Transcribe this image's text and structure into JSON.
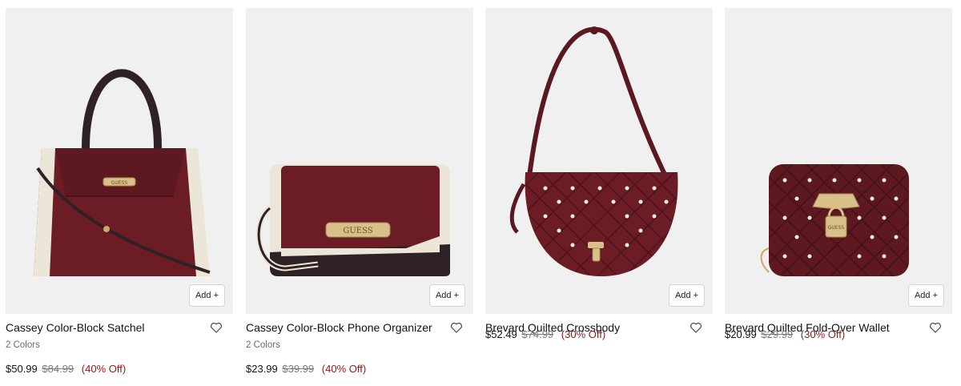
{
  "products": [
    {
      "name": "Cassey Color-Block Satchel",
      "colors": "2 Colors",
      "sale_price": "$50.99",
      "original_price": "$84.99",
      "discount": "(40% Off)",
      "add_label": "Add +"
    },
    {
      "name": "Cassey Color-Block Phone Organizer",
      "colors": "2 Colors",
      "sale_price": "$23.99",
      "original_price": "$39.99",
      "discount": "(40% Off)",
      "add_label": "Add +"
    },
    {
      "name": "Brevard Quilted Crossbody",
      "colors": "",
      "sale_price": "$52.49",
      "original_price": "$74.99",
      "discount": "(30% Off)",
      "add_label": "Add +"
    },
    {
      "name": "Brevard Quilted Fold-Over Wallet",
      "colors": "",
      "sale_price": "$20.99",
      "original_price": "$29.99",
      "discount": "(30% Off)",
      "add_label": "Add +"
    }
  ],
  "brand_mark": "GUESS",
  "theme": {
    "burgundy": "#6b1c24",
    "cream": "#ece6d8",
    "dark": "#2f2226",
    "gold": "#c9a86a",
    "discount_red": "#8b1a1a"
  },
  "icons": {
    "favorite": "heart-outline-icon"
  }
}
